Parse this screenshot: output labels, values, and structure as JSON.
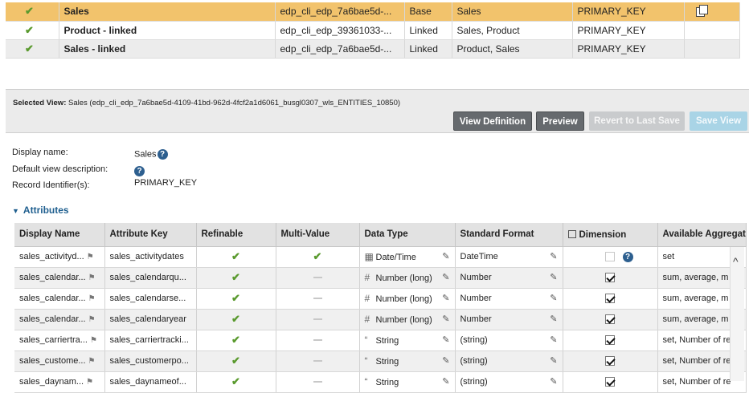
{
  "views": [
    {
      "name": "Sales",
      "key": "edp_cli_edp_7a6bae5d-...",
      "type": "Base",
      "entities": "Sales",
      "identifier": "PRIMARY_KEY",
      "selected": true
    },
    {
      "name": "Product - linked",
      "key": "edp_cli_edp_39361033-...",
      "type": "Linked",
      "entities": "Sales, Product",
      "identifier": "PRIMARY_KEY",
      "selected": false
    },
    {
      "name": "Sales - linked",
      "key": "edp_cli_edp_7a6bae5d-...",
      "type": "Linked",
      "entities": "Product, Sales",
      "identifier": "PRIMARY_KEY",
      "selected": false
    }
  ],
  "selected_view": {
    "label": "Selected View:",
    "value": "Sales (edp_cli_edp_7a6bae5d-4109-41bd-962d-4fcf2a1d6061_busgl0307_wls_ENTITIES_10850)"
  },
  "buttons": {
    "view_definition": "View Definition",
    "preview": "Preview",
    "revert": "Revert to Last Save",
    "save_view": "Save View"
  },
  "properties": {
    "display_name_label": "Display name:",
    "display_name_value": "Sales",
    "description_label": "Default view description:",
    "record_id_label": "Record Identifier(s):",
    "record_id_value": "PRIMARY_KEY"
  },
  "attributes_title": "Attributes",
  "columns": [
    "Display Name",
    "Attribute Key",
    "Refinable",
    "Multi-Value",
    "Data Type",
    "Standard Format",
    "Dimension",
    "Available Aggregat"
  ],
  "rows": [
    {
      "display": "sales_activityd...",
      "key": "sales_activitydates",
      "refinable": true,
      "multi": true,
      "type": "Date/Time",
      "type_icon": "calendar-icon",
      "format": "DateTime",
      "dimension": "unchecked",
      "agg": "set"
    },
    {
      "display": "sales_calendar...",
      "key": "sales_calendarqu...",
      "refinable": true,
      "multi": false,
      "type": "Number (long)",
      "type_icon": "hash-icon",
      "format": "Number",
      "dimension": "checked",
      "agg": "sum, average, m"
    },
    {
      "display": "sales_calendar...",
      "key": "sales_calendarse...",
      "refinable": true,
      "multi": false,
      "type": "Number (long)",
      "type_icon": "hash-icon",
      "format": "Number",
      "dimension": "checked",
      "agg": "sum, average, m"
    },
    {
      "display": "sales_calendar...",
      "key": "sales_calendaryear",
      "refinable": true,
      "multi": false,
      "type": "Number (long)",
      "type_icon": "hash-icon",
      "format": "Number",
      "dimension": "checked",
      "agg": "sum, average, m"
    },
    {
      "display": "sales_carriertra...",
      "key": "sales_carriertracki...",
      "refinable": true,
      "multi": false,
      "type": "String",
      "type_icon": "quote-icon",
      "format": "(string)",
      "dimension": "checked",
      "agg": "set, Number of re"
    },
    {
      "display": "sales_custome...",
      "key": "sales_customerpo...",
      "refinable": true,
      "multi": false,
      "type": "String",
      "type_icon": "quote-icon",
      "format": "(string)",
      "dimension": "checked",
      "agg": "set, Number of re"
    },
    {
      "display": "sales_daynam...",
      "key": "sales_daynameof...",
      "refinable": true,
      "multi": false,
      "type": "String",
      "type_icon": "quote-icon",
      "format": "(string)",
      "dimension": "checked",
      "agg": "set, Number of re"
    }
  ],
  "colors": {
    "selected_row": "#f2c36c",
    "check": "#5a9a2e",
    "accent": "#1f5f8f",
    "button_dark": "#666a6e"
  }
}
